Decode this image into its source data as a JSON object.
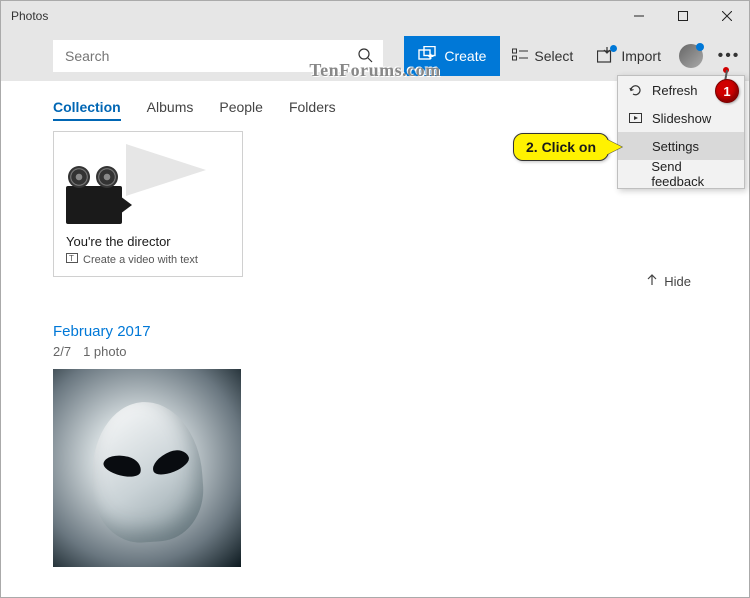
{
  "window": {
    "title": "Photos"
  },
  "toolbar": {
    "search_placeholder": "Search",
    "create_label": "Create",
    "select_label": "Select",
    "import_label": "Import"
  },
  "tabs": {
    "collection": "Collection",
    "albums": "Albums",
    "people": "People",
    "folders": "Folders"
  },
  "promo_card": {
    "title": "You're the director",
    "subtitle": "Create a video with text"
  },
  "hide_label": "Hide",
  "section": {
    "heading": "February 2017",
    "date": "2/7",
    "count": "1 photo"
  },
  "menu": {
    "refresh": "Refresh",
    "slideshow": "Slideshow",
    "settings": "Settings",
    "send_feedback": "Send feedback"
  },
  "annotations": {
    "badge1": "1",
    "callout": "2. Click on"
  },
  "watermark": "TenForums.com"
}
